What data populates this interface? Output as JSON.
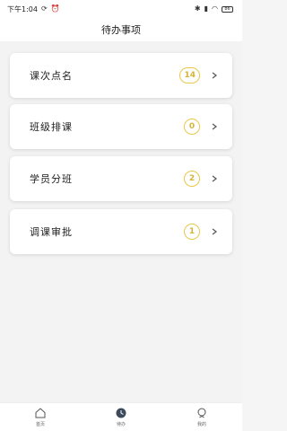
{
  "status_bar": {
    "time": "下午1:04",
    "left_icons": [
      "sync-icon",
      "alarm-icon"
    ],
    "right_icons": [
      "bluetooth-icon",
      "signal-icon",
      "wifi-icon",
      "battery-icon"
    ],
    "battery": "86"
  },
  "header": {
    "title": "待办事项"
  },
  "tasks": [
    {
      "label": "课次点名",
      "count": "14"
    },
    {
      "label": "班级排课",
      "count": "0"
    },
    {
      "label": "学员分班",
      "count": "2"
    },
    {
      "label": "调课审批",
      "count": "1"
    }
  ],
  "colors": {
    "badge": "#d6b43a",
    "active_nav": "#3d4a5c"
  },
  "bottom_nav": [
    {
      "label": "首页",
      "icon": "home-icon",
      "active": false
    },
    {
      "label": "待办",
      "icon": "todo-icon",
      "active": true
    },
    {
      "label": "我的",
      "icon": "profile-icon",
      "active": false
    }
  ]
}
